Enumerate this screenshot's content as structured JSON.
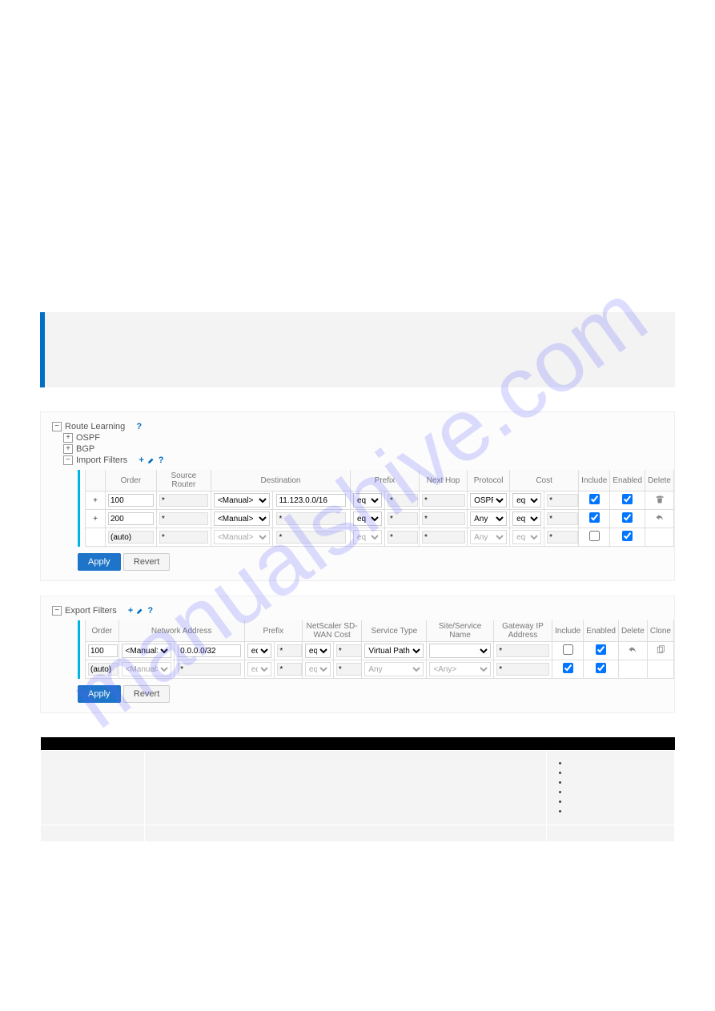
{
  "watermark": "manualshive.com",
  "notebox_text": "",
  "route_learning": {
    "label": "Route Learning",
    "ospf": "OSPF",
    "bgp": "BGP"
  },
  "import_filters": {
    "label": "Import Filters",
    "headers": {
      "order": "Order",
      "source_router": "Source Router",
      "destination": "Destination",
      "prefix": "Prefix",
      "next_hop": "Next Hop",
      "protocol": "Protocol",
      "cost": "Cost",
      "include": "Include",
      "enabled": "Enabled",
      "delete": "Delete"
    },
    "rows": [
      {
        "order": "100",
        "source_router": "*",
        "dest_sel": "<Manual>",
        "dest_val": "11.123.0.0/16",
        "prefix_op": "eq",
        "prefix_val": "*",
        "next_hop": "*",
        "protocol": "OSPF",
        "cost_op": "eq",
        "cost_val": "*",
        "include": true,
        "enabled": true
      },
      {
        "order": "200",
        "source_router": "*",
        "dest_sel": "<Manual>",
        "dest_val": "*",
        "prefix_op": "eq",
        "prefix_val": "*",
        "next_hop": "*",
        "protocol": "Any",
        "cost_op": "eq",
        "cost_val": "*",
        "include": true,
        "enabled": true
      },
      {
        "order": "(auto)",
        "source_router": "*",
        "dest_sel": "<Manual>",
        "dest_val": "*",
        "prefix_op": "eq",
        "prefix_val": "*",
        "next_hop": "*",
        "protocol": "Any",
        "cost_op": "eq",
        "cost_val": "*",
        "include": false,
        "enabled": true
      }
    ]
  },
  "export_filters": {
    "label": "Export Filters",
    "headers": {
      "order": "Order",
      "network_address": "Network Address",
      "prefix": "Prefix",
      "sdwan_cost": "NetScaler SD-WAN Cost",
      "service_type": "Service Type",
      "site_service": "Site/Service Name",
      "gateway_ip": "Gateway IP Address",
      "include": "Include",
      "enabled": "Enabled",
      "delete": "Delete",
      "clone": "Clone"
    },
    "rows": [
      {
        "order": "100",
        "na_sel": "<Manual>",
        "na_val": "0.0.0.0/32",
        "prefix_op": "eq",
        "prefix_val": "*",
        "cost_op": "eq",
        "cost_val": "*",
        "service_type": "Virtual Path",
        "site_service": "",
        "gateway_ip": "*",
        "include": false,
        "enabled": true
      },
      {
        "order": "(auto)",
        "na_sel": "<Manual>",
        "na_val": "*",
        "prefix_op": "eq",
        "prefix_val": "*",
        "cost_op": "eq",
        "cost_val": "*",
        "service_type": "Any",
        "site_service": "<Any>",
        "gateway_ip": "*",
        "include": true,
        "enabled": true
      }
    ]
  },
  "buttons": {
    "apply": "Apply",
    "revert": "Revert"
  },
  "doc_table": {
    "headers": [
      "",
      "",
      ""
    ],
    "bullets": [
      "",
      "",
      "",
      "",
      "",
      ""
    ]
  },
  "footer": {
    "left": "",
    "right": ""
  }
}
